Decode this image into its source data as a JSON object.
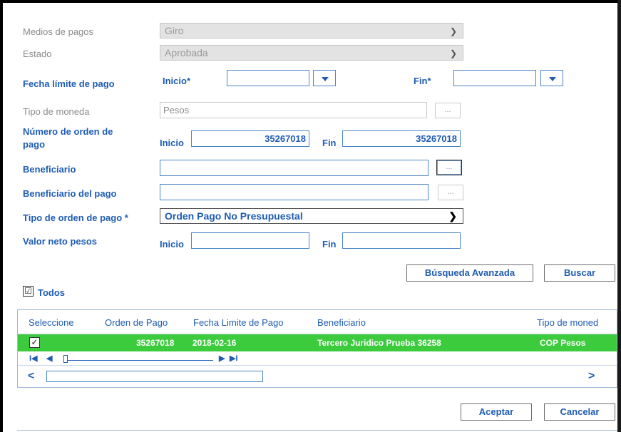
{
  "form": {
    "medios_label": "Medios de pagos",
    "medios_value": "Giro",
    "estado_label": "Estado",
    "estado_value": "Aprobada",
    "fecha_label": "Fecha límite de pago",
    "fecha_inicio_label": "Inicio*",
    "fecha_fin_label": "Fin*",
    "moneda_label": "Tipo de moneda",
    "moneda_value": "Pesos",
    "numero_label_1": "Número de orden de",
    "numero_label_2": "pago",
    "numero_inicio_label": "Inicio",
    "numero_inicio_value": "35267018",
    "numero_fin_label": "Fin",
    "numero_fin_value": "35267018",
    "beneficiario_label": "Beneficiario",
    "beneficiario_pago_label": "Beneficiario del pago",
    "tipo_orden_label": "Tipo de orden de pago  *",
    "tipo_orden_value": "Orden Pago No Presupuestal",
    "valor_label": "Valor neto pesos",
    "valor_inicio_label": "Inicio",
    "valor_fin_label": "Fin",
    "ellipsis": "..."
  },
  "buttons": {
    "busqueda_avanzada": "Búsqueda Avanzada",
    "buscar": "Buscar",
    "aceptar": "Aceptar",
    "cancelar": "Cancelar"
  },
  "todos": {
    "label": "Todos",
    "checked": "☑"
  },
  "grid": {
    "columns": [
      "Seleccione",
      "Orden de Pago",
      "Fecha Limite de Pago",
      "Beneficiario",
      "Tipo de moned"
    ],
    "rows": [
      {
        "check": "✓",
        "orden": "35267018",
        "fecha": "2018-02-16",
        "beneficiario": "Tercero Juridico Prueba 36258",
        "tipo": "COP Pesos"
      }
    ],
    "row_color": "#3ccb3c"
  },
  "pager": {
    "first": "I◀",
    "prev": "◀",
    "next": "▶",
    "last": "▶I"
  },
  "scroll": {
    "left": "<",
    "right": ">"
  },
  "colors": {
    "accent": "#1f5db3",
    "selected_row": "#3ccb3c"
  }
}
